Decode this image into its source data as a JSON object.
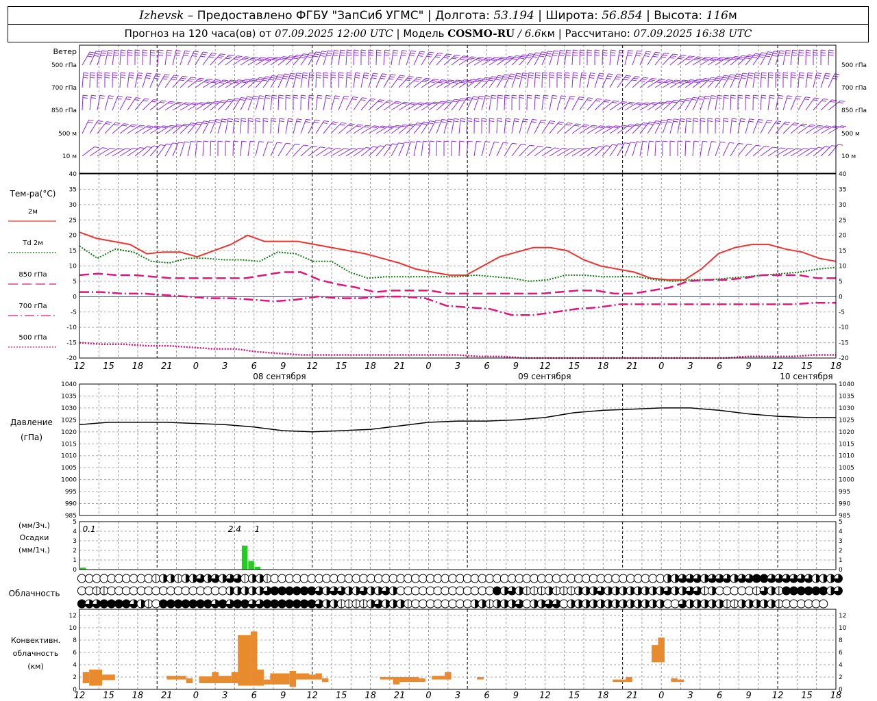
{
  "header": {
    "line1": {
      "city": "Izhevsk",
      "provider": " – Предоставлено ФГБУ \"ЗапСиб УГМС\" | Долгота: ",
      "lon": "53.194",
      "lat_label": " | Широта: ",
      "lat": "56.854",
      "alt_label": " | Высота: ",
      "alt": "116",
      "alt_unit": "м"
    },
    "line2": {
      "prefix": "Прогноз на 120 часа(ов) от ",
      "issued": "07.09.2025 12:00 UTC",
      "model_label": " | Модель ",
      "model": "COSMO-RU",
      "res": " / 6.6",
      "res_unit": "км",
      "calc_label": " | Рассчитано: ",
      "calc": "07.09.2025 16:38 UTC"
    }
  },
  "labels": {
    "wind_title": "Ветер",
    "wind_levels": [
      "500 гПа",
      "700 гПа",
      "850 гПа",
      "500 м",
      "10 м"
    ],
    "temp_title": "Тем-ра(°C)",
    "temp_legend": [
      "2м",
      "Td  2м",
      "850 гПа",
      "700 гПа",
      "500 гПа"
    ],
    "pressure_title": [
      "Давление",
      "(гПа)"
    ],
    "precip_title": [
      "(мм/3ч.)",
      "Осадки",
      "(мм/1ч.)"
    ],
    "cloud_title": "Облачность",
    "conv_title": [
      "Конвективн.",
      "облачность",
      "(км)"
    ]
  },
  "time_axis": {
    "hour_ticks": [
      "12",
      "15",
      "18",
      "21",
      "0",
      "3",
      "6",
      "9",
      "12",
      "15",
      "18",
      "21",
      "0",
      "3",
      "6",
      "9",
      "12",
      "15",
      "18",
      "21",
      "0",
      "3",
      "6",
      "9",
      "12",
      "15",
      "18"
    ],
    "days": [
      "08 сентября",
      "09 сентября",
      "10 сентября"
    ]
  },
  "colors": {
    "wind": "#8a2be2",
    "t2m": "#ee3333",
    "td2m": "#117711",
    "t850": "#e0157a",
    "t700": "#e0157a",
    "t500": "#e0157a",
    "pressure": "#000000",
    "precip": "#22cc22",
    "convective": "#e88a2e"
  },
  "chart_data": [
    {
      "type": "line",
      "title": "Тем-ра(°C)",
      "x_hours": [
        0,
        3,
        6,
        9,
        12,
        15,
        18,
        21,
        24,
        27,
        30,
        33,
        36,
        39,
        42,
        45,
        48,
        51,
        54,
        57,
        60,
        63,
        66,
        69,
        72,
        75,
        78,
        81,
        84,
        87,
        90,
        93,
        96,
        99,
        102,
        105,
        108,
        111,
        114,
        117,
        120
      ],
      "ylim": [
        -20,
        40
      ],
      "y_ticks": [
        -20,
        -15,
        -10,
        -5,
        0,
        5,
        10,
        15,
        20,
        25,
        30,
        35,
        40
      ],
      "series": [
        {
          "name": "2м",
          "style": "solid",
          "values": [
            21,
            19,
            18,
            17,
            14,
            14.5,
            14.5,
            13,
            15,
            17,
            20,
            18,
            18,
            18,
            17,
            16,
            15,
            14,
            12.5,
            11,
            9,
            8,
            7,
            7,
            10,
            13,
            14.5,
            16,
            16,
            15,
            12,
            10,
            9,
            8,
            6,
            5.5,
            5.5,
            9,
            14,
            16,
            17,
            17,
            15.5,
            14.5,
            12.5,
            11.5
          ]
        },
        {
          "name": "Td  2м",
          "style": "dotted",
          "values": [
            16.5,
            12.5,
            15.5,
            14.5,
            11.5,
            11,
            12.5,
            12.5,
            12,
            12,
            11.5,
            14.5,
            14,
            11.5,
            11.5,
            8,
            6,
            6.5,
            6.5,
            6.5,
            6.5,
            6.5,
            7,
            6.5,
            6,
            5,
            5.5,
            7,
            7,
            6.5,
            6.5,
            6.5,
            5.5,
            5,
            5.5,
            5.5,
            6,
            6.5,
            7,
            7.5,
            8,
            9,
            9.5
          ]
        },
        {
          "name": "850 гПа",
          "style": "dash",
          "values": [
            7,
            7.5,
            7,
            7,
            6.5,
            6,
            6,
            6,
            6,
            6,
            7,
            8,
            8,
            5.5,
            4,
            3,
            1.5,
            2,
            2,
            2,
            1,
            1,
            1,
            1,
            1,
            1,
            1.5,
            2,
            2,
            1,
            1,
            2,
            3,
            5,
            5.5,
            5.5,
            6,
            7,
            7,
            7,
            6,
            6
          ]
        },
        {
          "name": "700 гПа",
          "style": "dashdot",
          "values": [
            1.5,
            1.5,
            1,
            1,
            0.5,
            0,
            -0.5,
            -0.5,
            -1,
            -1.5,
            -1,
            0,
            -0.5,
            -0.5,
            0,
            0,
            -0.5,
            -3,
            -3.5,
            -4,
            -6,
            -6,
            -5,
            -4,
            -3.5,
            -2.5,
            -2.5,
            -2.5,
            -2.5,
            -2.5,
            -2.5,
            -2.5,
            -2.5,
            -2.5,
            -2,
            -2
          ]
        },
        {
          "name": "500 гПа",
          "style": "dotfine",
          "values": [
            -15,
            -15.5,
            -15.5,
            -16,
            -16,
            -16.5,
            -17,
            -17,
            -18,
            -18.5,
            -19,
            -19,
            -19,
            -19,
            -19,
            -19,
            -19,
            -19,
            -19.5,
            -19.5,
            -20,
            -20,
            -20,
            -20,
            -20,
            -20,
            -20,
            -20,
            -20,
            -20,
            -19.5,
            -19.5,
            -19.5,
            -19,
            -19
          ]
        }
      ]
    },
    {
      "type": "line",
      "title": "Давление",
      "ylabel": "(гПа)",
      "ylim": [
        985,
        1040
      ],
      "y_ticks": [
        985,
        990,
        995,
        1000,
        1005,
        1010,
        1015,
        1020,
        1025,
        1030,
        1035,
        1040
      ],
      "series": [
        {
          "name": "Давление",
          "values": [
            1023,
            1024,
            1024,
            1024,
            1023.5,
            1023,
            1022,
            1020.5,
            1020,
            1020.5,
            1021,
            1022.5,
            1024,
            1024.5,
            1024.5,
            1025,
            1026,
            1028,
            1029,
            1029.5,
            1030,
            1030,
            1029,
            1027.5,
            1026.5,
            1026,
            1026
          ]
        }
      ]
    },
    {
      "type": "bar",
      "title": "Осадки",
      "ylim": [
        0,
        5
      ],
      "y_ticks": [
        0,
        1,
        2,
        3,
        4,
        5
      ],
      "bars_hours": [
        {
          "h": 0.5,
          "v": 0.2
        },
        {
          "h": 25.5,
          "v": 2.5
        },
        {
          "h": 26.5,
          "v": 0.9
        },
        {
          "h": 27.5,
          "v": 0.3
        }
      ],
      "annotations": [
        {
          "h": 1.5,
          "text": "0.1"
        },
        {
          "h": 24,
          "text": "2.4"
        },
        {
          "h": 27.5,
          "text": "1"
        }
      ]
    },
    {
      "type": "heatmap",
      "title": "Облачность",
      "rows": [
        [
          0,
          0,
          0,
          0,
          0,
          0,
          0,
          0,
          0,
          0,
          1,
          2,
          2,
          1,
          2,
          2,
          3,
          2,
          3,
          2,
          3,
          3,
          1,
          2,
          2,
          1,
          0,
          0,
          0,
          0,
          0,
          0,
          0,
          0,
          0,
          0,
          0,
          0,
          0,
          0,
          0,
          0,
          0,
          0,
          0,
          0,
          0,
          0,
          0,
          0,
          0,
          0,
          0,
          0,
          0,
          0,
          0,
          0,
          0,
          0,
          0,
          0,
          0,
          0,
          0,
          0,
          0,
          0,
          0,
          0,
          0,
          0,
          0,
          0,
          0,
          0,
          0,
          0,
          0,
          2,
          2,
          3,
          3,
          3,
          2,
          3,
          3,
          3,
          2,
          3,
          3,
          4,
          4,
          3,
          3,
          3,
          3,
          3,
          3,
          2,
          2,
          2,
          3
        ],
        [
          0,
          0,
          1,
          1,
          0,
          0,
          0,
          0,
          0,
          0,
          0,
          0,
          0,
          0,
          0,
          0,
          0,
          0,
          0,
          0,
          2,
          2,
          2,
          2,
          2,
          3,
          4,
          4,
          4,
          4,
          4,
          4,
          3,
          2,
          3,
          3,
          2,
          2,
          3,
          2,
          2,
          3,
          2,
          0,
          0,
          0,
          0,
          0,
          0,
          0,
          0,
          0,
          0,
          0,
          0,
          0,
          4,
          2,
          3,
          2,
          1,
          1,
          1,
          2,
          1,
          1,
          1,
          2,
          2,
          2,
          3,
          2,
          2,
          2,
          2,
          2,
          2,
          2,
          2,
          3,
          2,
          2,
          3,
          3,
          1,
          2,
          0,
          0,
          0,
          0,
          0,
          1,
          3,
          2,
          1,
          4,
          4,
          4,
          4,
          4,
          4,
          2,
          3
        ],
        [
          4,
          3,
          3,
          4,
          4,
          4,
          4,
          3,
          2,
          1,
          0,
          4,
          4,
          4,
          4,
          4,
          4,
          4,
          3,
          4,
          3,
          4,
          4,
          3,
          3,
          4,
          4,
          4,
          4,
          4,
          4,
          4,
          3,
          2,
          2,
          1,
          1,
          1,
          1,
          2,
          3,
          2,
          2,
          2,
          1,
          0,
          0,
          0,
          0,
          0,
          0,
          0,
          0,
          2,
          2,
          1,
          2,
          2,
          2,
          3,
          0,
          2,
          2,
          3,
          3,
          0,
          2,
          2,
          2,
          2,
          2,
          2,
          2,
          2,
          2,
          2,
          2,
          2,
          2,
          0,
          0,
          3,
          2,
          2,
          2,
          2,
          2,
          1,
          1,
          2,
          2,
          2,
          2,
          2,
          1,
          0,
          0,
          0,
          0,
          0,
          0
        ]
      ]
    },
    {
      "type": "bar",
      "title": "Конвективн. облачность",
      "ylabel": "(км)",
      "ylim": [
        0,
        13
      ],
      "y_ticks": [
        0,
        2,
        4,
        6,
        8,
        10,
        12
      ],
      "segments": [
        {
          "h0": 0.5,
          "h1": 1.5,
          "b": 1.0,
          "t": 2.8
        },
        {
          "h0": 1.5,
          "h1": 3.5,
          "b": 0.6,
          "t": 3.2
        },
        {
          "h0": 3.5,
          "h1": 5.5,
          "b": 1.5,
          "t": 2.4
        },
        {
          "h0": 13.5,
          "h1": 16.5,
          "b": 1.6,
          "t": 2.2
        },
        {
          "h0": 16.5,
          "h1": 17.5,
          "b": 1.0,
          "t": 1.8
        },
        {
          "h0": 18.5,
          "h1": 20.5,
          "b": 1.0,
          "t": 2.1
        },
        {
          "h0": 20.5,
          "h1": 21.5,
          "b": 1.0,
          "t": 2.8
        },
        {
          "h0": 21.5,
          "h1": 23.5,
          "b": 1.0,
          "t": 2.2
        },
        {
          "h0": 23.5,
          "h1": 24.5,
          "b": 1.0,
          "t": 2.8
        },
        {
          "h0": 24.5,
          "h1": 26.5,
          "b": 0.6,
          "t": 8.8
        },
        {
          "h0": 26.5,
          "h1": 27.5,
          "b": 0.6,
          "t": 9.4
        },
        {
          "h0": 27.5,
          "h1": 28.5,
          "b": 0.6,
          "t": 3.2
        },
        {
          "h0": 28.5,
          "h1": 29.5,
          "b": 0.8,
          "t": 1.6
        },
        {
          "h0": 29.5,
          "h1": 32.5,
          "b": 0.8,
          "t": 2.6
        },
        {
          "h0": 32.5,
          "h1": 33.5,
          "b": 0.4,
          "t": 3.0
        },
        {
          "h0": 33.5,
          "h1": 35.5,
          "b": 1.6,
          "t": 2.6
        },
        {
          "h0": 35.5,
          "h1": 36.5,
          "b": 1.6,
          "t": 2.4
        },
        {
          "h0": 36.5,
          "h1": 37.5,
          "b": 1.6,
          "t": 2.6
        },
        {
          "h0": 37.5,
          "h1": 38.5,
          "b": 1.2,
          "t": 1.8
        },
        {
          "h0": 46.5,
          "h1": 48.5,
          "b": 1.6,
          "t": 2.0
        },
        {
          "h0": 48.5,
          "h1": 49.5,
          "b": 0.8,
          "t": 2.0
        },
        {
          "h0": 49.5,
          "h1": 52.5,
          "b": 1.2,
          "t": 2.0
        },
        {
          "h0": 52.5,
          "h1": 53.5,
          "b": 1.2,
          "t": 1.8
        },
        {
          "h0": 54.5,
          "h1": 56.5,
          "b": 1.6,
          "t": 2.2
        },
        {
          "h0": 56.5,
          "h1": 57.5,
          "b": 1.6,
          "t": 2.8
        },
        {
          "h0": 61.5,
          "h1": 62.5,
          "b": 1.6,
          "t": 2.0
        },
        {
          "h0": 82.5,
          "h1": 84.5,
          "b": 1.2,
          "t": 1.6
        },
        {
          "h0": 84.5,
          "h1": 85.5,
          "b": 1.2,
          "t": 2.0
        },
        {
          "h0": 88.5,
          "h1": 89.5,
          "b": 4.4,
          "t": 7.2
        },
        {
          "h0": 89.5,
          "h1": 90.5,
          "b": 4.4,
          "t": 8.4
        },
        {
          "h0": 91.5,
          "h1": 92.5,
          "b": 1.2,
          "t": 1.8
        },
        {
          "h0": 92.5,
          "h1": 93.5,
          "b": 1.2,
          "t": 1.6
        }
      ]
    },
    {
      "type": "scatter",
      "title": "Ветер",
      "levels": [
        "500 гПа",
        "700 гПа",
        "850 гПа",
        "500 м",
        "10 м"
      ],
      "speed_by_level": [
        14,
        12,
        9,
        8,
        3
      ]
    }
  ]
}
